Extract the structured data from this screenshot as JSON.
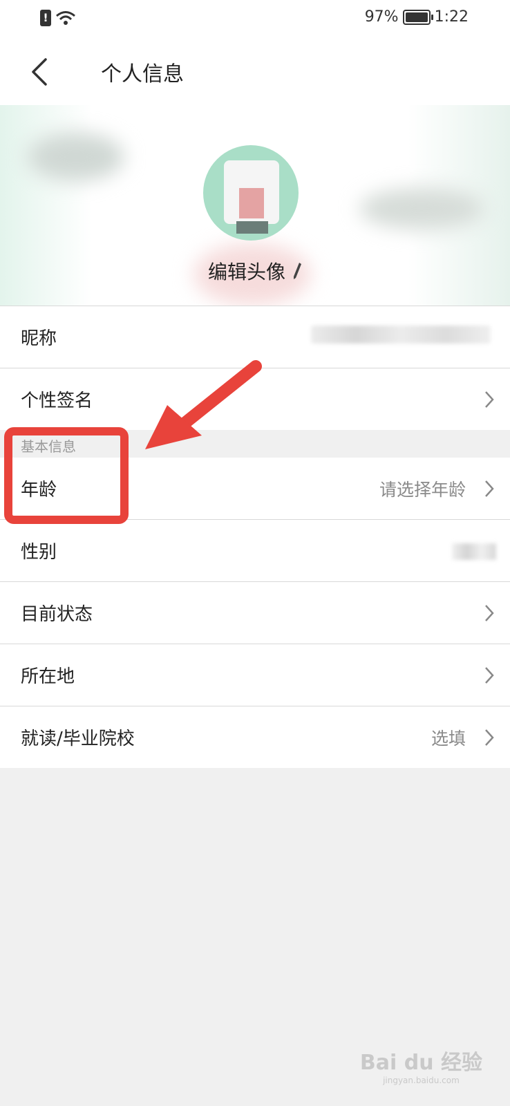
{
  "status_bar": {
    "battery": "97%",
    "time": "1:22"
  },
  "header": {
    "title": "个人信息"
  },
  "avatar_section": {
    "edit_label": "编辑头像"
  },
  "profile_rows": [
    {
      "label": "昵称",
      "value": ""
    },
    {
      "label": "个性签名",
      "value": ""
    }
  ],
  "basic_info": {
    "section_title": "基本信息",
    "rows": [
      {
        "label": "年龄",
        "value": "请选择年龄"
      },
      {
        "label": "性别",
        "value": ""
      },
      {
        "label": "目前状态",
        "value": ""
      },
      {
        "label": "所在地",
        "value": ""
      },
      {
        "label": "就读/毕业院校",
        "value": "选填"
      }
    ]
  },
  "watermark": {
    "text": "Bai du 经验",
    "sub": "jingyan.baidu.com"
  },
  "colors": {
    "annotation": "#e8433b",
    "background": "#f0f0f0"
  }
}
